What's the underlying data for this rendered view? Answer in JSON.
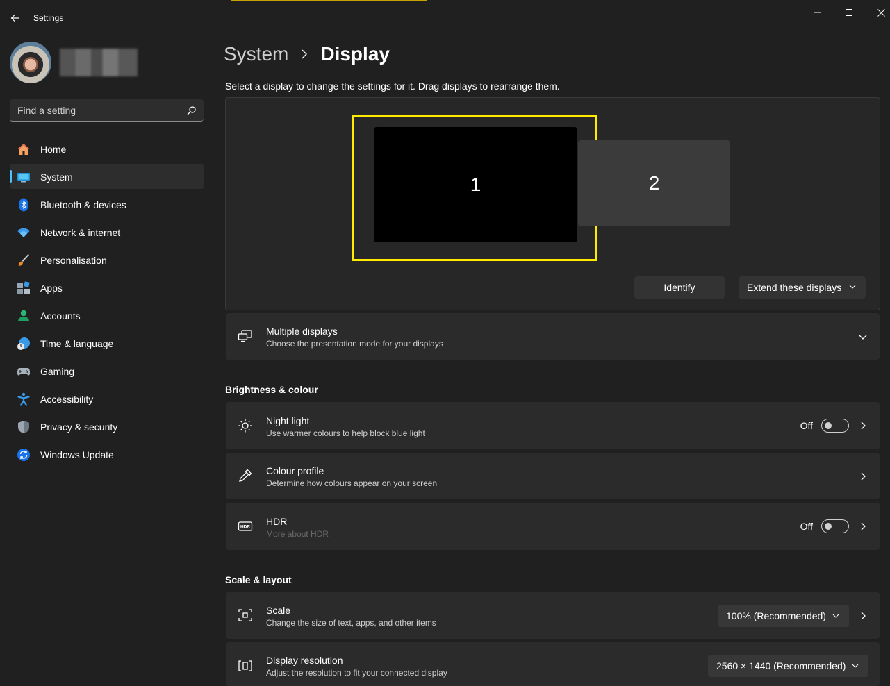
{
  "app": {
    "title": "Settings"
  },
  "sidebar": {
    "search_placeholder": "Find a setting",
    "items": [
      {
        "label": "Home",
        "icon": "home-icon"
      },
      {
        "label": "System",
        "icon": "system-icon",
        "active": true
      },
      {
        "label": "Bluetooth & devices",
        "icon": "bluetooth-icon"
      },
      {
        "label": "Network & internet",
        "icon": "network-icon"
      },
      {
        "label": "Personalisation",
        "icon": "brush-icon"
      },
      {
        "label": "Apps",
        "icon": "apps-icon"
      },
      {
        "label": "Accounts",
        "icon": "accounts-icon"
      },
      {
        "label": "Time & language",
        "icon": "time-language-icon"
      },
      {
        "label": "Gaming",
        "icon": "gaming-icon"
      },
      {
        "label": "Accessibility",
        "icon": "accessibility-icon"
      },
      {
        "label": "Privacy & security",
        "icon": "shield-icon"
      },
      {
        "label": "Windows Update",
        "icon": "update-icon"
      }
    ]
  },
  "breadcrumb": {
    "parent": "System",
    "current": "Display"
  },
  "display": {
    "hint": "Select a display to change the settings for it. Drag displays to rearrange them.",
    "monitor1": "1",
    "monitor2": "2",
    "identify_label": "Identify",
    "mode_label": "Extend these displays"
  },
  "multiple_displays": {
    "title": "Multiple displays",
    "subtitle": "Choose the presentation mode for your displays"
  },
  "brightness": {
    "header": "Brightness & colour",
    "night_light": {
      "title": "Night light",
      "subtitle": "Use warmer colours to help block blue light",
      "state": "Off"
    },
    "colour_profile": {
      "title": "Colour profile",
      "subtitle": "Determine how colours appear on your screen"
    },
    "hdr": {
      "title": "HDR",
      "subtitle": "More about HDR",
      "state": "Off"
    }
  },
  "scale_layout": {
    "header": "Scale & layout",
    "scale": {
      "title": "Scale",
      "subtitle": "Change the size of text, apps, and other items",
      "value": "100% (Recommended)"
    },
    "resolution": {
      "title": "Display resolution",
      "subtitle": "Adjust the resolution to fit your connected display",
      "value": "2560 × 1440 (Recommended)"
    }
  },
  "colors": {
    "background": "#202020",
    "card": "#2b2b2b",
    "accent": "#4cc2ff",
    "selection": "#ffea00"
  }
}
